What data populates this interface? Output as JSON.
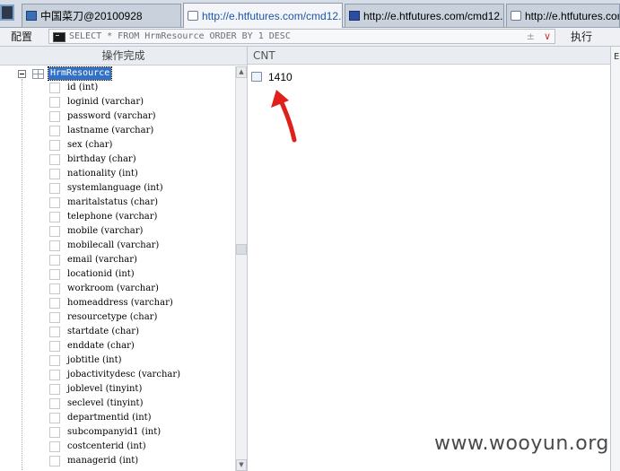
{
  "tabs": [
    {
      "title": "中国菜刀@20100928",
      "icon": "grid-icon"
    },
    {
      "title": "http://e.htfutures.com/cmd12...",
      "icon": "page-icon"
    },
    {
      "title": "http://e.htfutures.com/cmd12...",
      "icon": "flag-icon"
    },
    {
      "title": "http://e.htfutures.com/",
      "icon": "page-icon"
    }
  ],
  "toolbar": {
    "config_label": "配置",
    "sql_query": "SELECT * FROM HrmResource ORDER BY 1 DESC",
    "sql_plusminus": "±",
    "sql_dropdown": "∨",
    "run_label": "执行"
  },
  "left_panel": {
    "header": "操作完成",
    "root": "HrmResource",
    "columns": [
      "id (int)",
      "loginid (varchar)",
      "password (varchar)",
      "lastname (varchar)",
      "sex (char)",
      "birthday (char)",
      "nationality (int)",
      "systemlanguage (int)",
      "maritalstatus (char)",
      "telephone (varchar)",
      "mobile (varchar)",
      "mobilecall (varchar)",
      "email (varchar)",
      "locationid (int)",
      "workroom (varchar)",
      "homeaddress (varchar)",
      "resourcetype (char)",
      "startdate (char)",
      "enddate (char)",
      "jobtitle (int)",
      "jobactivitydesc (varchar)",
      "joblevel (tinyint)",
      "seclevel (tinyint)",
      "departmentid (int)",
      "subcompanyid1 (int)",
      "costcenterid (int)",
      "managerid (int)"
    ]
  },
  "result": {
    "column_header": "CNT",
    "value": "1410"
  },
  "right_edge_label": "E",
  "watermark": "www.wooyun.org",
  "colors": {
    "selection": "#3271c6",
    "arrow": "#e0201a",
    "tab_active_text": "#1f56a8"
  }
}
